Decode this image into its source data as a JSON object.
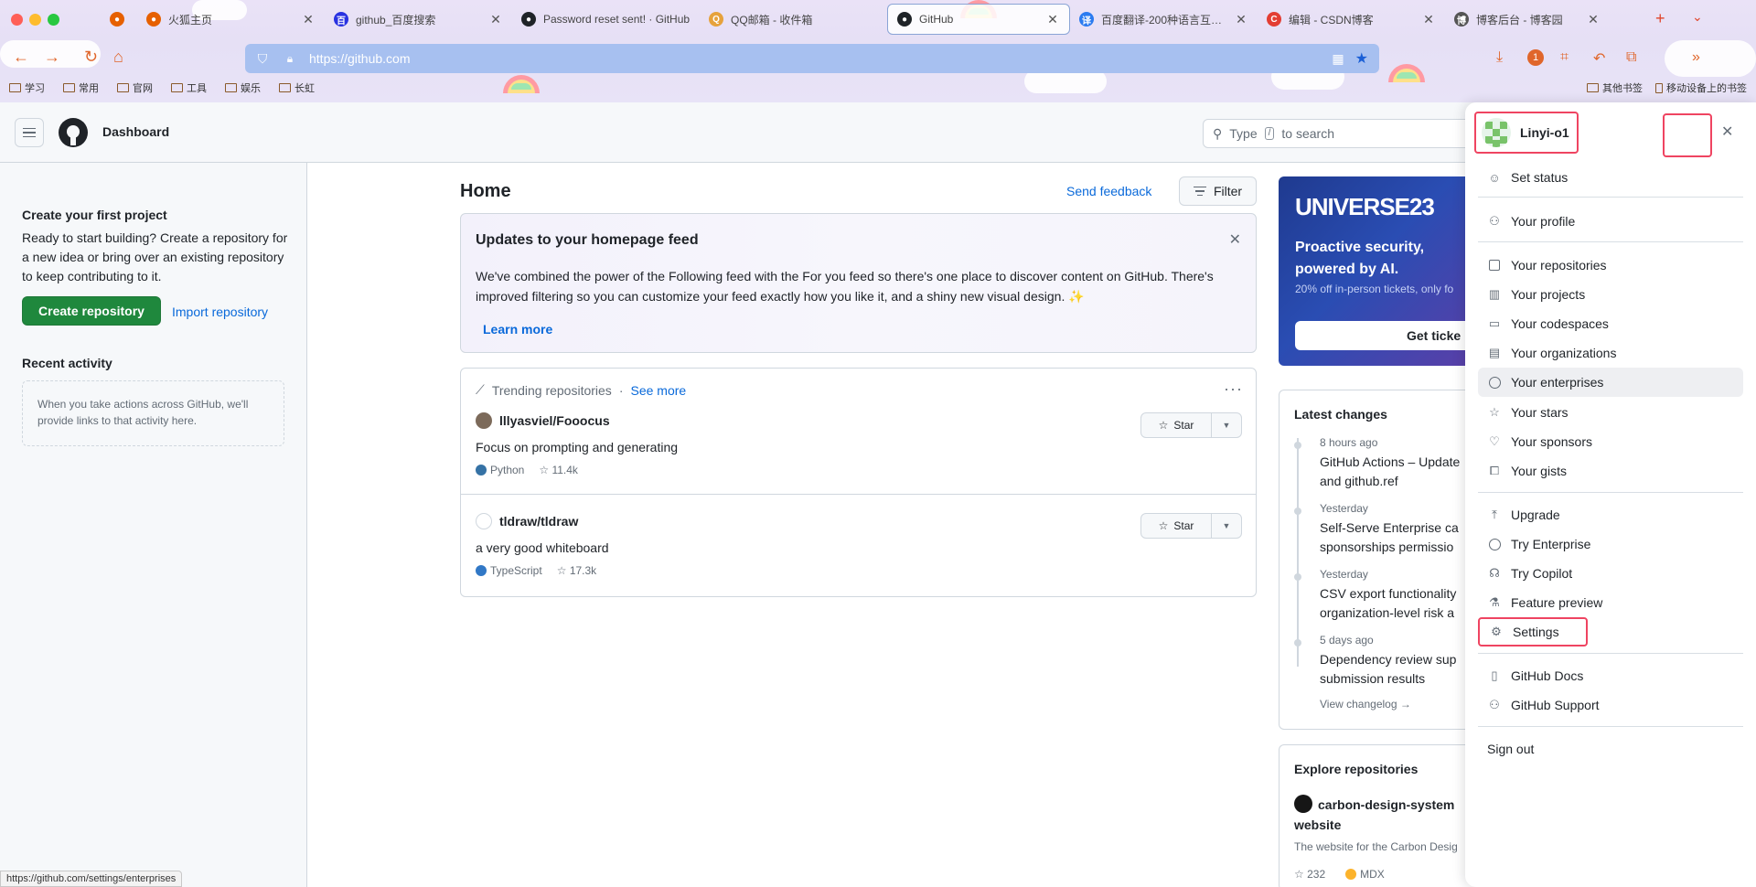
{
  "browser": {
    "tabs": [
      {
        "title": "",
        "favicon_color": "#e66000"
      },
      {
        "title": "火狐主页",
        "favicon_color": "#e66000"
      },
      {
        "title": "github_百度搜索",
        "favicon_color": "#2932e1"
      },
      {
        "title": "Password reset sent! · GitHub",
        "favicon_color": "#1f2328"
      },
      {
        "title": "QQ邮箱 - 收件箱",
        "favicon_color": "#e6a23c"
      },
      {
        "title": "GitHub",
        "favicon_color": "#1f2328"
      },
      {
        "title": "百度翻译-200种语言互译、沟通全世界",
        "favicon_color": "#2b7bf0"
      },
      {
        "title": "编辑 - CSDN博客",
        "favicon_color": "#e33e33"
      },
      {
        "title": "博客后台 - 博客园",
        "favicon_color": "#555555"
      }
    ],
    "url": "https://github.com",
    "bookmarks": [
      "学习",
      "常用",
      "官网",
      "工具",
      "娱乐",
      "长虹"
    ],
    "bookmarks_right": [
      "其他书签",
      "移动设备上的书签"
    ],
    "badge_count": "1",
    "status_url": "https://github.com/settings/enterprises"
  },
  "header": {
    "title": "Dashboard",
    "search_prefix": "Type",
    "search_key": "/",
    "search_suffix": "to search"
  },
  "sidebar": {
    "heading": "Create your first project",
    "text": "Ready to start building? Create a repository for a new idea or bring over an existing repository to keep contributing to it.",
    "create_button": "Create repository",
    "import_link": "Import repository",
    "recent_heading": "Recent activity",
    "recent_empty": "When you take actions across GitHub, we'll provide links to that activity here."
  },
  "feed": {
    "title": "Home",
    "send_feedback": "Send feedback",
    "filter": "Filter",
    "updates": {
      "title": "Updates to your homepage feed",
      "body": "We've combined the power of the Following feed with the For you feed so there's one place to discover content on GitHub. There's improved filtering so you can customize your feed exactly how you like it, and a shiny new visual design. ✨",
      "learn_more": "Learn more"
    },
    "trending": {
      "label": "Trending repositories",
      "separator": "·",
      "see_more": "See more",
      "repos": [
        {
          "name": "lllyasviel/Fooocus",
          "description": "Focus on prompting and generating",
          "language": "Python",
          "lang_color": "#3572A5",
          "stars": "11.4k",
          "star_label": "Star"
        },
        {
          "name": "tldraw/tldraw",
          "description": "a very good whiteboard",
          "language": "TypeScript",
          "lang_color": "#3178c6",
          "stars": "17.3k",
          "star_label": "Star"
        }
      ]
    }
  },
  "right": {
    "universe": {
      "logo": "UNIVERSE23",
      "headline": "Proactive security, powered by AI.",
      "sub": "20% off in-person tickets, only fo",
      "button": "Get ticke"
    },
    "latest": {
      "heading": "Latest changes",
      "items": [
        {
          "when": "8 hours ago",
          "what1": "GitHub Actions – Update",
          "what2": "and github.ref"
        },
        {
          "when": "Yesterday",
          "what1": "Self-Serve Enterprise ca",
          "what2": "sponsorships permissio"
        },
        {
          "when": "Yesterday",
          "what1": "CSV export functionality",
          "what2": "organization-level risk a"
        },
        {
          "when": "5 days ago",
          "what1": "Dependency review sup",
          "what2": "submission results"
        }
      ],
      "changelog": "View changelog →"
    },
    "explore": {
      "heading": "Explore repositories",
      "repo": "carbon-design-system website",
      "desc": "The website for the Carbon Desig",
      "stars": "232",
      "language": "MDX",
      "lang_color": "#fcb32c"
    }
  },
  "menu": {
    "username": "Linyi-o1",
    "items": [
      {
        "label": "Set status",
        "icon": "smiley-icon"
      },
      {
        "label": "Your profile",
        "icon": "person-icon"
      },
      {
        "label": "Your repositories",
        "icon": "repo-icon"
      },
      {
        "label": "Your projects",
        "icon": "project-icon"
      },
      {
        "label": "Your codespaces",
        "icon": "codespaces-icon"
      },
      {
        "label": "Your organizations",
        "icon": "organization-icon"
      },
      {
        "label": "Your enterprises",
        "icon": "globe-icon"
      },
      {
        "label": "Your stars",
        "icon": "star-icon"
      },
      {
        "label": "Your sponsors",
        "icon": "heart-icon"
      },
      {
        "label": "Your gists",
        "icon": "code-square-icon"
      },
      {
        "label": "Upgrade",
        "icon": "upload-icon"
      },
      {
        "label": "Try Enterprise",
        "icon": "globe-icon"
      },
      {
        "label": "Try Copilot",
        "icon": "copilot-icon"
      },
      {
        "label": "Feature preview",
        "icon": "beaker-icon"
      },
      {
        "label": "Settings",
        "icon": "gear-icon"
      },
      {
        "label": "GitHub Docs",
        "icon": "book-icon"
      },
      {
        "label": "GitHub Support",
        "icon": "people-icon"
      },
      {
        "label": "Sign out",
        "icon": ""
      }
    ]
  },
  "colors": {
    "accent_link": "#0969da",
    "primary_button": "#1f883d",
    "highlight_box": "#ef4461"
  }
}
